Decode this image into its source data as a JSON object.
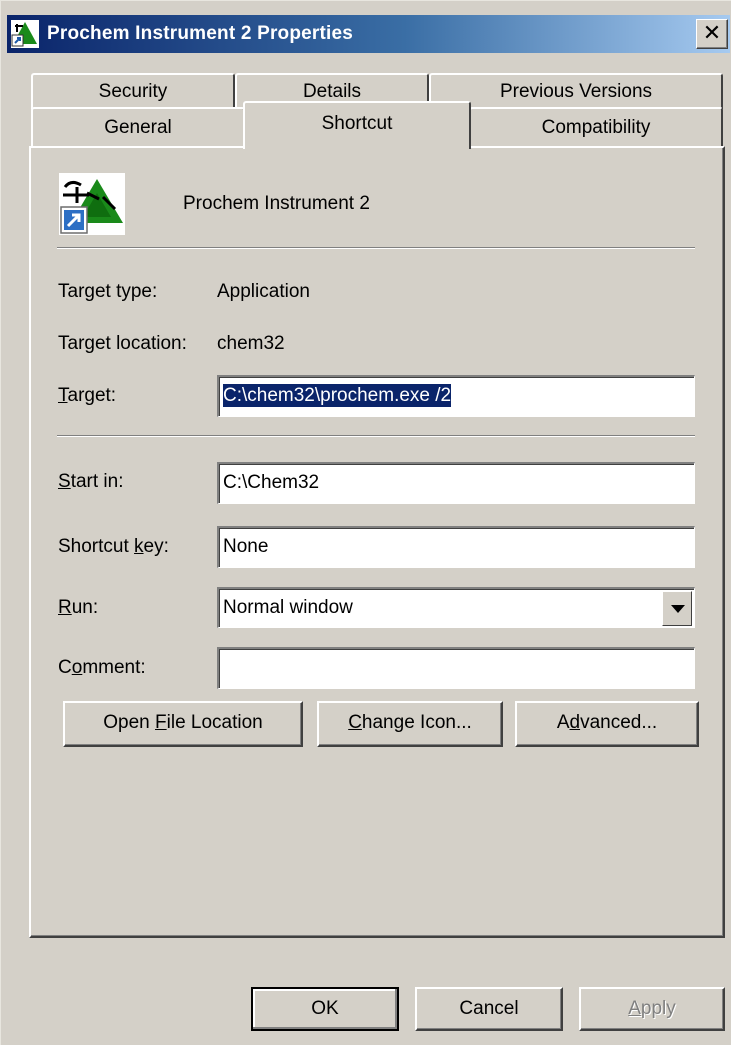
{
  "window": {
    "title": "Prochem Instrument 2 Properties",
    "close_label": "✕"
  },
  "tabs": {
    "row1": [
      "Security",
      "Details",
      "Previous Versions"
    ],
    "row2": [
      "General",
      "Shortcut",
      "Compatibility"
    ],
    "active": "Shortcut"
  },
  "shortcut": {
    "name": "Prochem Instrument 2",
    "target_type_label": "Target type:",
    "target_type_value": "Application",
    "target_location_label": "Target location:",
    "target_location_value": "chem32",
    "target_label_pre": "",
    "target_label_key": "T",
    "target_label_post": "arget:",
    "target_value": "C:\\chem32\\prochem.exe /2",
    "start_in_label_key": "S",
    "start_in_label_post": "tart in:",
    "start_in_value": "C:\\Chem32",
    "shortcut_key_label_pre": "Shortcut ",
    "shortcut_key_label_key": "k",
    "shortcut_key_label_post": "ey:",
    "shortcut_key_value": "None",
    "run_label_key": "R",
    "run_label_post": "un:",
    "run_value": "Normal window",
    "comment_label_pre": "C",
    "comment_label_key": "o",
    "comment_label_post": "mment:",
    "comment_value": ""
  },
  "buttons": {
    "open_file_location": {
      "pre": "Open ",
      "key": "F",
      "post": "ile Location"
    },
    "change_icon": {
      "pre": "",
      "key": "C",
      "post": "hange Icon..."
    },
    "advanced": {
      "pre": "A",
      "key": "d",
      "post": "vanced..."
    },
    "ok": "OK",
    "cancel": "Cancel",
    "apply": {
      "pre": "",
      "key": "A",
      "post": "pply"
    }
  },
  "colors": {
    "title_bar_start": "#0a246a",
    "title_bar_end": "#a6caf0",
    "face": "#d4d0c8",
    "selection": "#0a246a"
  },
  "icons": {
    "title_icon": "app-shortcut-icon",
    "app_icon": "chem-logo-icon",
    "shortcut_overlay": "shortcut-arrow-icon"
  }
}
